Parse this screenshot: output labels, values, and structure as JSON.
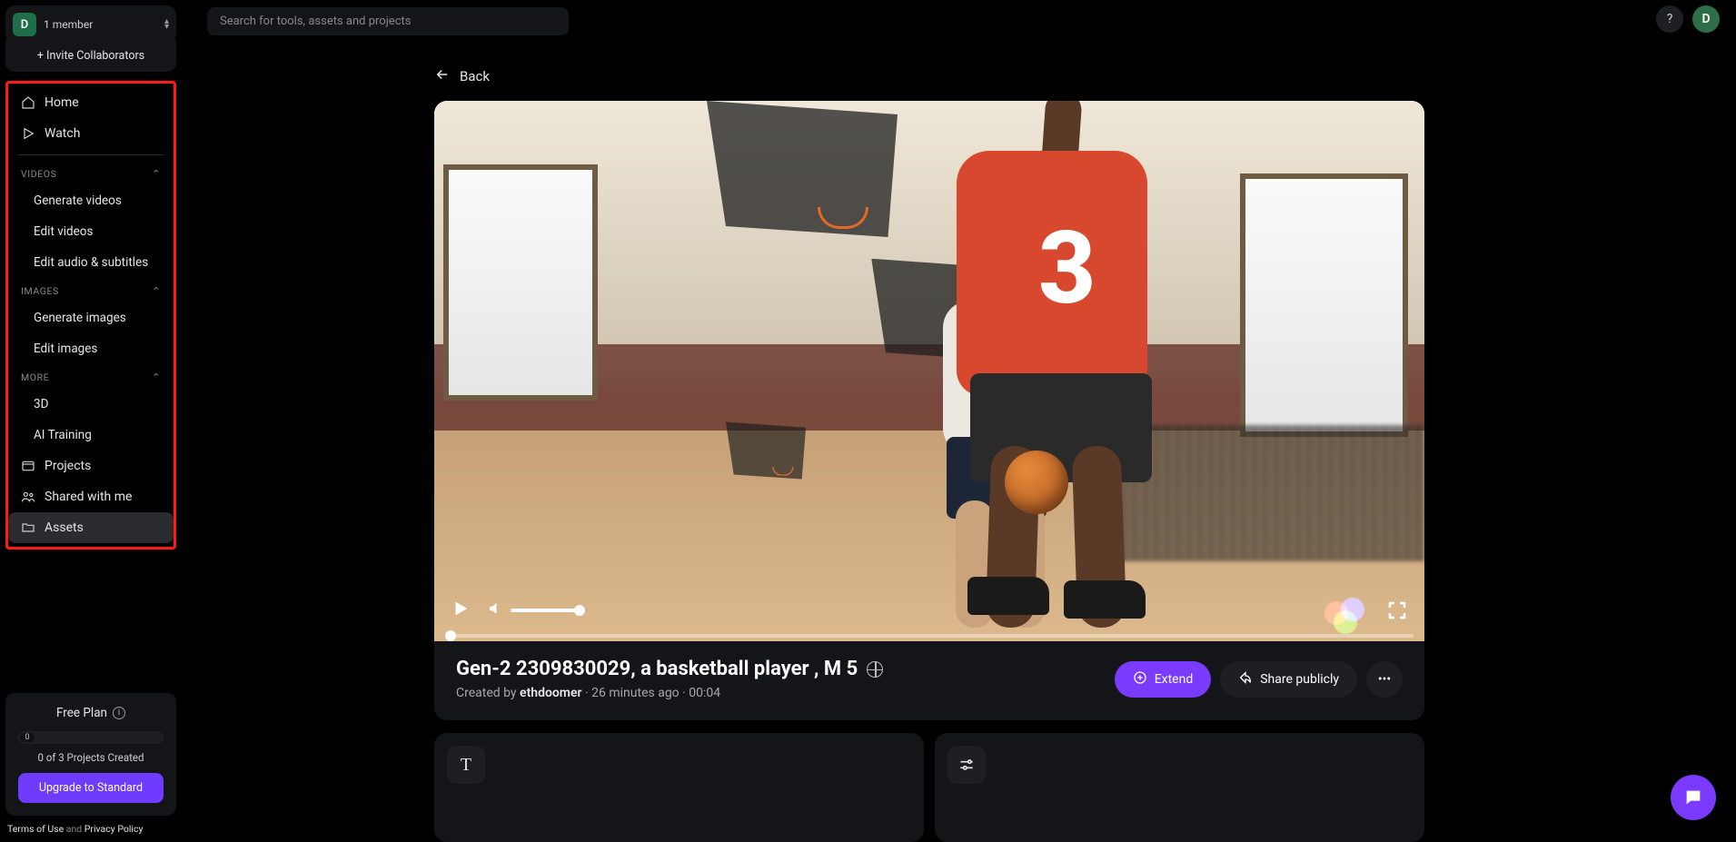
{
  "workspace": {
    "avatar_letter": "D",
    "members_text": "1 member",
    "invite_label": "+ Invite Collaborators"
  },
  "top": {
    "search_placeholder": "Search for tools, assets and projects",
    "help_glyph": "?",
    "user_avatar_letter": "D"
  },
  "nav": {
    "home": "Home",
    "watch": "Watch",
    "sections": {
      "videos": {
        "title": "VIDEOS",
        "items": [
          "Generate videos",
          "Edit videos",
          "Edit audio & subtitles"
        ]
      },
      "images": {
        "title": "IMAGES",
        "items": [
          "Generate images",
          "Edit images"
        ]
      },
      "more": {
        "title": "MORE",
        "items": [
          "3D",
          "AI Training"
        ]
      }
    },
    "projects": "Projects",
    "shared": "Shared with me",
    "assets": "Assets"
  },
  "plan": {
    "title": "Free Plan",
    "usage_value": "0",
    "projects_text": "0 of 3 Projects Created",
    "upgrade_label": "Upgrade to Standard"
  },
  "legal": {
    "terms": "Terms of Use",
    "and": " and ",
    "privacy": "Privacy Policy"
  },
  "back_label": "Back",
  "asset": {
    "title": "Gen-2 2309830029, a basketball player , M 5",
    "jersey_number": "3",
    "created_prefix": "Created by ",
    "author": "ethdoomer",
    "sep1": " · ",
    "age": "26 minutes ago",
    "sep2": " · ",
    "duration": "00:04",
    "extend_label": "Extend",
    "share_label": "Share publicly",
    "more_glyph": "•••"
  },
  "panel_icons": {
    "text_glyph": "T"
  }
}
